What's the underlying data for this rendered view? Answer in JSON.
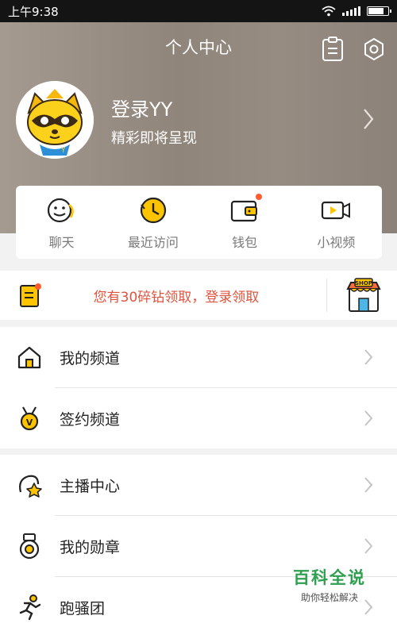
{
  "status_bar": {
    "time": "上午9:38",
    "battery_level": 0.85
  },
  "header": {
    "title": "个人中心",
    "icons": [
      "clipboard-icon",
      "settings-icon"
    ]
  },
  "profile": {
    "name": "登录YY",
    "subtitle": "精彩即将呈现"
  },
  "quick_actions": [
    {
      "label": "聊天",
      "icon": "chat-icon",
      "badge": false
    },
    {
      "label": "最近访问",
      "icon": "clock-icon",
      "badge": false
    },
    {
      "label": "钱包",
      "icon": "wallet-icon",
      "badge": true
    },
    {
      "label": "小视频",
      "icon": "video-icon",
      "badge": false
    }
  ],
  "promo": {
    "text": "您有30碎钻领取，登录领取",
    "left_icon": "task-card-icon",
    "right_icon": "shop-icon",
    "shop_text": "SHOP"
  },
  "menu_group_1": [
    {
      "label": "我的频道",
      "icon": "house-icon"
    },
    {
      "label": "签约频道",
      "icon": "medal-icon"
    }
  ],
  "menu_group_2": [
    {
      "label": "主播中心",
      "icon": "anchor-star-icon"
    },
    {
      "label": "我的勋章",
      "icon": "badge-icon"
    },
    {
      "label": "跑骚团",
      "icon": "runner-icon"
    }
  ],
  "watermark": {
    "title": "百科全说",
    "subtitle": "助你轻松解决"
  },
  "colors": {
    "accent_yellow": "#ffc400",
    "promo_red": "#e0533c",
    "watermark_green": "#2ea04f",
    "badge_red": "#ff5a30"
  }
}
